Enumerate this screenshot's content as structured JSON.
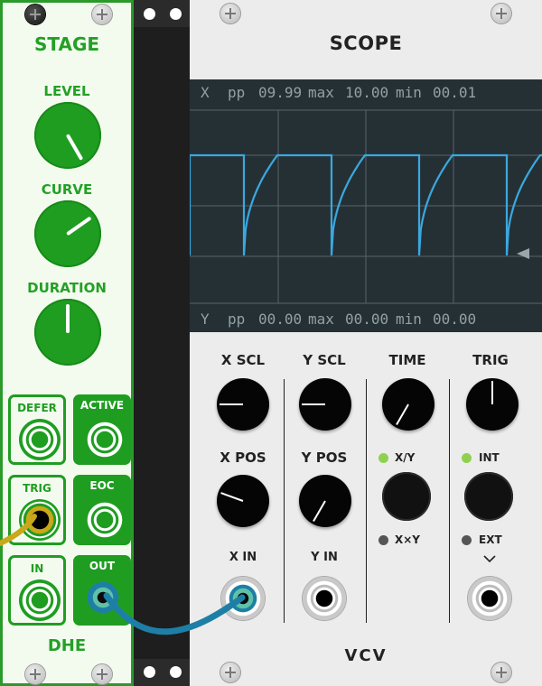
{
  "stage": {
    "title": "STAGE",
    "knobs": [
      {
        "label": "LEVEL"
      },
      {
        "label": "CURVE"
      },
      {
        "label": "DURATION"
      }
    ],
    "ports": [
      {
        "label": "DEFER"
      },
      {
        "label": "ACTIVE"
      },
      {
        "label": "TRIG"
      },
      {
        "label": "EOC"
      },
      {
        "label": "IN"
      },
      {
        "label": "OUT"
      }
    ],
    "brand": "DHE"
  },
  "scope": {
    "title": "SCOPE",
    "display": {
      "x": {
        "channel": "X",
        "pp_label": "pp",
        "pp": "09.99",
        "max_label": "max",
        "max": "10.00",
        "min_label": "min",
        "min": "00.01"
      },
      "y": {
        "channel": "Y",
        "pp_label": "pp",
        "pp": "00.00",
        "max_label": "max",
        "max": "00.00",
        "min_label": "min",
        "min": "00.00"
      }
    },
    "controls": {
      "x_scl": "X SCL",
      "y_scl": "Y SCL",
      "time": "TIME",
      "trig": "TRIG",
      "x_pos": "X POS",
      "y_pos": "Y POS",
      "mode_xy": "X/Y",
      "mode_xxy": "X×Y",
      "trig_int": "INT",
      "trig_ext": "EXT",
      "x_in": "X IN",
      "y_in": "Y IN"
    },
    "logo": "VCV"
  },
  "colors": {
    "stage_green": "#1f9d21",
    "stage_bg": "#f3fbef",
    "trace": "#3aa8e0",
    "screen_bg": "#253035",
    "led_on": "#8fd14f",
    "led_off": "#555555",
    "cable_yellow": "#c9a81a",
    "cable_blue": "#1e7fa6"
  }
}
